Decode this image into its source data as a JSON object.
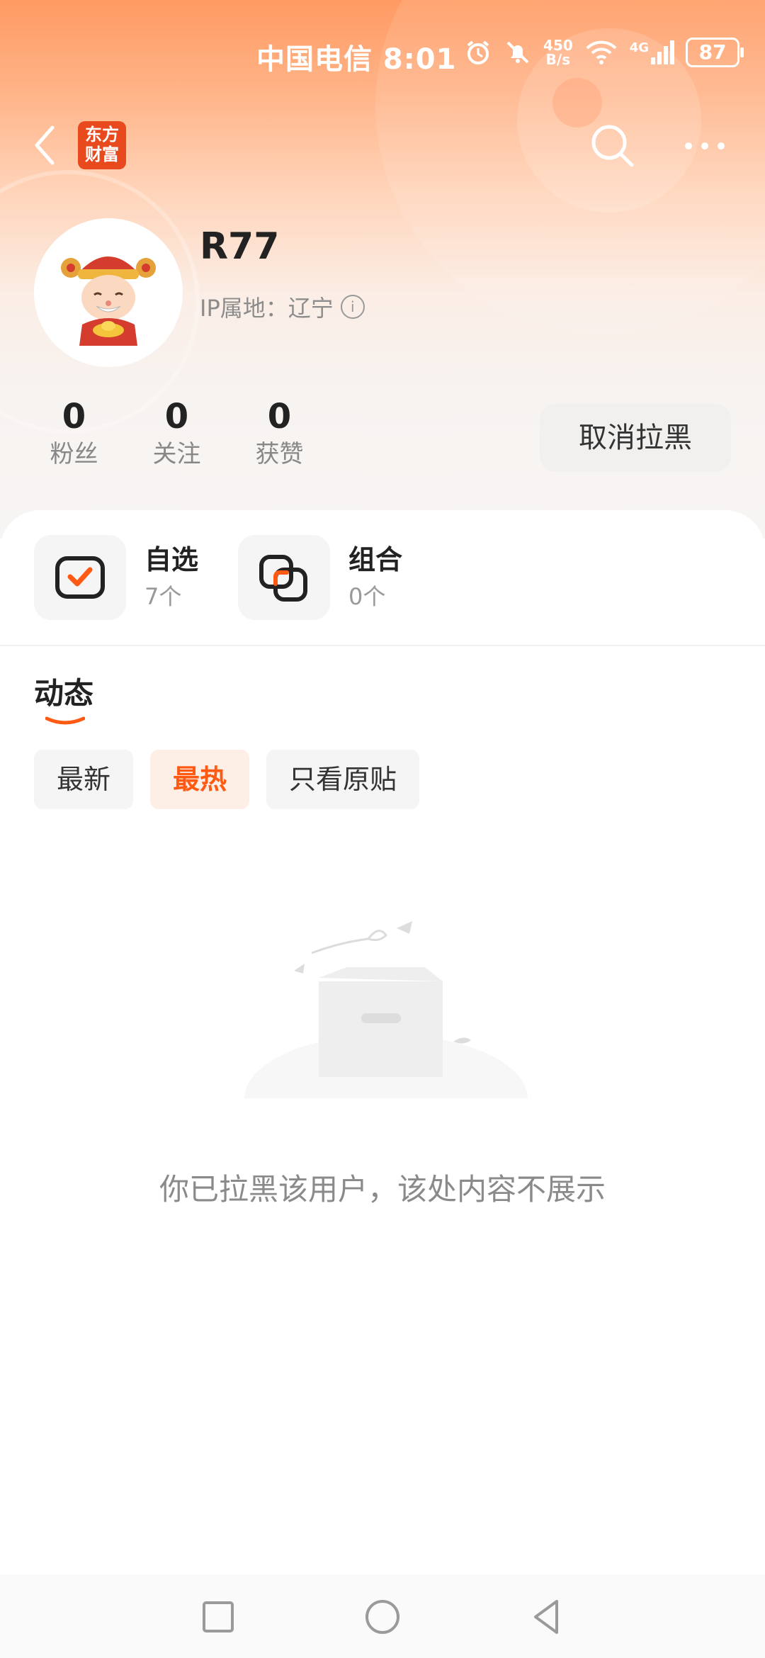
{
  "status_bar": {
    "carrier_time": "中国电信 8:01",
    "speed_top": "450",
    "speed_bottom": "B/s",
    "network": "4G",
    "battery": "87"
  },
  "nav": {
    "logo_line1": "东方",
    "logo_line2": "财富"
  },
  "profile": {
    "username": "R77",
    "ip_location": "IP属地：辽宁",
    "stats": [
      {
        "num": "0",
        "label": "粉丝"
      },
      {
        "num": "0",
        "label": "关注"
      },
      {
        "num": "0",
        "label": "获赞"
      }
    ],
    "unblock_label": "取消拉黑"
  },
  "features": [
    {
      "title": "自选",
      "count": "7个"
    },
    {
      "title": "组合",
      "count": "0个"
    }
  ],
  "section": {
    "title": "动态",
    "filters": [
      "最新",
      "最热",
      "只看原贴"
    ],
    "active_filter": "最热"
  },
  "empty_state": {
    "message": "你已拉黑该用户，该处内容不展示"
  },
  "colors": {
    "accent": "#ff5a14",
    "brand": "#e8491d"
  }
}
